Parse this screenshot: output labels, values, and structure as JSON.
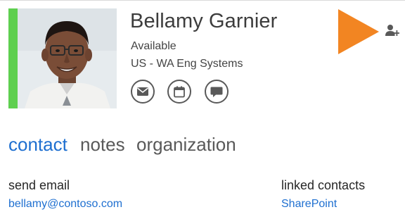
{
  "contact": {
    "name": "Bellamy Garnier",
    "status": "Available",
    "department": "US - WA Eng Systems",
    "presence_color": "#5ecf4f"
  },
  "actions": [
    {
      "name": "email-action-button",
      "icon": "envelope-icon"
    },
    {
      "name": "calendar-action-button",
      "icon": "calendar-icon"
    },
    {
      "name": "im-action-button",
      "icon": "chat-bubble-icon"
    }
  ],
  "header_controls": {
    "play_icon": "play-icon",
    "play_color": "#f28522",
    "add_contact_icon": "add-contact-icon"
  },
  "tabs": [
    {
      "label": "contact",
      "active": true
    },
    {
      "label": "notes",
      "active": false
    },
    {
      "label": "organization",
      "active": false
    }
  ],
  "details": {
    "send_email_label": "send email",
    "email": "bellamy@contoso.com",
    "linked_contacts_label": "linked contacts",
    "linked_contact": "SharePoint"
  },
  "colors": {
    "accent": "#1e6fd0",
    "text": "#262626"
  }
}
